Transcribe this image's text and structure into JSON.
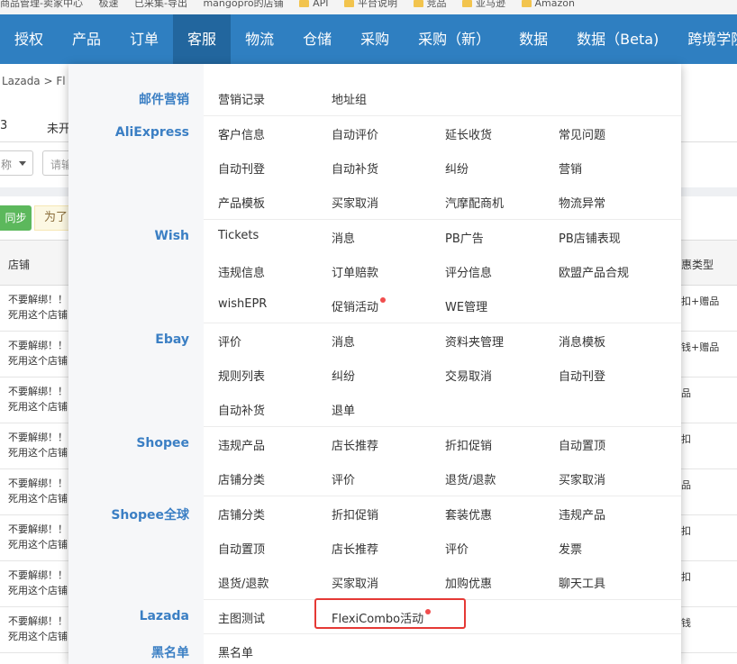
{
  "bookmarks": [
    "商品管理-卖家中心",
    "极速",
    "已采集-导出",
    "mangopro的店铺",
    "API",
    "平台说明",
    "竞品",
    "亚马逊",
    "Amazon"
  ],
  "nav": [
    "授权",
    "产品",
    "订单",
    "客服",
    "物流",
    "仓储",
    "采购",
    "采购（新）",
    "数据",
    "数据（Beta)",
    "跨境学院"
  ],
  "breadcrumb": "Lazada  >  Fl",
  "tabs": [
    "3",
    "未开"
  ],
  "filter": {
    "select_label": "称",
    "input_placeholder": "请输"
  },
  "toolbar": {
    "sync_label": "同步",
    "notice": "为了"
  },
  "table": {
    "shop_header": "店铺",
    "type_header": "惠类型",
    "rows": [
      {
        "shop_line1": "不要解绑！！",
        "shop_line2": "死用这个店铺",
        "type": "扣+赠品"
      },
      {
        "shop_line1": "不要解绑！！",
        "shop_line2": "死用这个店铺",
        "type": "钱+赠品"
      },
      {
        "shop_line1": "不要解绑！！",
        "shop_line2": "死用这个店铺",
        "type": "品"
      },
      {
        "shop_line1": "不要解绑！！",
        "shop_line2": "死用这个店铺",
        "type": "扣"
      },
      {
        "shop_line1": "不要解绑！！",
        "shop_line2": "死用这个店铺",
        "type": "品"
      },
      {
        "shop_line1": "不要解绑！！",
        "shop_line2": "死用这个店铺",
        "type": "扣"
      },
      {
        "shop_line1": "不要解绑！！",
        "shop_line2": "死用这个店铺",
        "type": "扣"
      },
      {
        "shop_line1": "不要解绑！！",
        "shop_line2": "死用这个店铺",
        "type": "钱"
      }
    ]
  },
  "menu": {
    "sections": [
      "邮件营销",
      "AliExpress",
      "Wish",
      "Ebay",
      "Shopee",
      "Shopee全球",
      "Lazada",
      "黑名单"
    ],
    "items": [
      "营销记录",
      "地址组",
      "客户信息",
      "自动评价",
      "延长收货",
      "常见问题",
      "自动刊登",
      "自动补货",
      "纠纷",
      "营销",
      "产品模板",
      "买家取消",
      "汽摩配商机",
      "物流异常",
      "Tickets",
      "消息",
      "PB广告",
      "PB店铺表现",
      "违规信息",
      "订单赔款",
      "评分信息",
      "欧盟产品合规",
      "wishEPR",
      "促销活动",
      "WE管理",
      "评价",
      "消息",
      "资料夹管理",
      "消息模板",
      "规则列表",
      "纠纷",
      "交易取消",
      "自动刊登",
      "自动补货",
      "退单",
      "违规产品",
      "店长推荐",
      "折扣促销",
      "自动置顶",
      "店铺分类",
      "评价",
      "退货/退款",
      "买家取消",
      "店铺分类",
      "折扣促销",
      "套装优惠",
      "违规产品",
      "自动置顶",
      "店长推荐",
      "评价",
      "发票",
      "退货/退款",
      "买家取消",
      "加购优惠",
      "聊天工具",
      "主图测试",
      "FlexiCombo活动",
      "黑名单"
    ]
  }
}
